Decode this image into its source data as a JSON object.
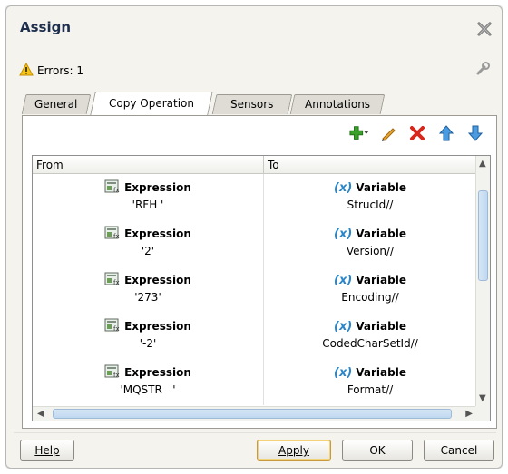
{
  "dialog": {
    "title": "Assign",
    "errors_label": "Errors: 1"
  },
  "tabs": [
    {
      "label": "General",
      "active": false
    },
    {
      "label": "Copy Operation",
      "active": true
    },
    {
      "label": "Sensors",
      "active": false
    },
    {
      "label": "Annotations",
      "active": false
    }
  ],
  "toolbar": {
    "icons": [
      "add-icon",
      "edit-icon",
      "delete-icon",
      "move-up-icon",
      "move-down-icon"
    ]
  },
  "table": {
    "headers": {
      "from": "From",
      "to": "To"
    },
    "rows": [
      {
        "from_type": "Expression",
        "from_value": "'RFH '",
        "to_type": "Variable",
        "to_value": "StrucId//"
      },
      {
        "from_type": "Expression",
        "from_value": "'2'",
        "to_type": "Variable",
        "to_value": "Version//"
      },
      {
        "from_type": "Expression",
        "from_value": "'273'",
        "to_type": "Variable",
        "to_value": "Encoding//"
      },
      {
        "from_type": "Expression",
        "from_value": "'-2'",
        "to_type": "Variable",
        "to_value": "CodedCharSetId//"
      },
      {
        "from_type": "Expression",
        "from_value": "'MQSTR   '",
        "to_type": "Variable",
        "to_value": "Format//"
      }
    ],
    "variable_icon_text": "(x)"
  },
  "buttons": {
    "help": "Help",
    "apply": "Apply",
    "ok": "OK",
    "cancel": "Cancel"
  },
  "colors": {
    "title": "#1e2f4d",
    "variable_accent": "#2a86c8",
    "delete_red": "#d8261c",
    "add_green": "#3aa02a"
  }
}
